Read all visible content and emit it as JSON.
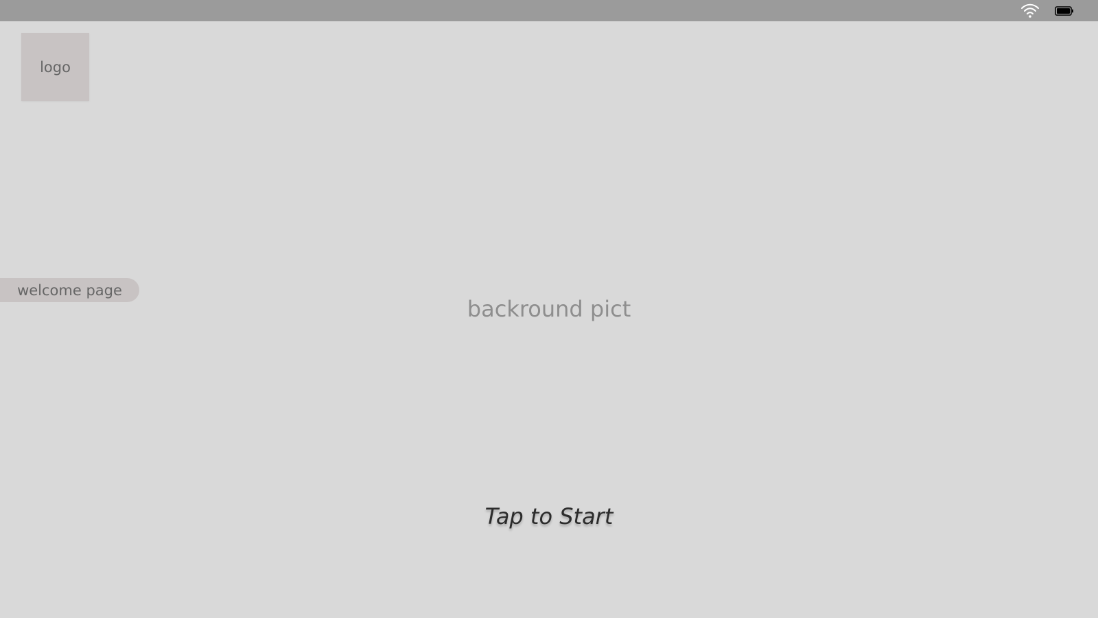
{
  "status_bar": {
    "wifi_icon": "wifi-icon",
    "battery_icon": "battery-icon"
  },
  "logo": {
    "label": "logo"
  },
  "welcome_tag": {
    "label": "welcome page"
  },
  "background": {
    "label": "backround pict"
  },
  "cta": {
    "label": "Tap to Start"
  },
  "colors": {
    "background": "#d9d9d9",
    "status_bar": "#9b9b9b",
    "placeholder": "#c8c3c3",
    "muted_text": "#666666",
    "cta_text": "#2c2c2c"
  }
}
